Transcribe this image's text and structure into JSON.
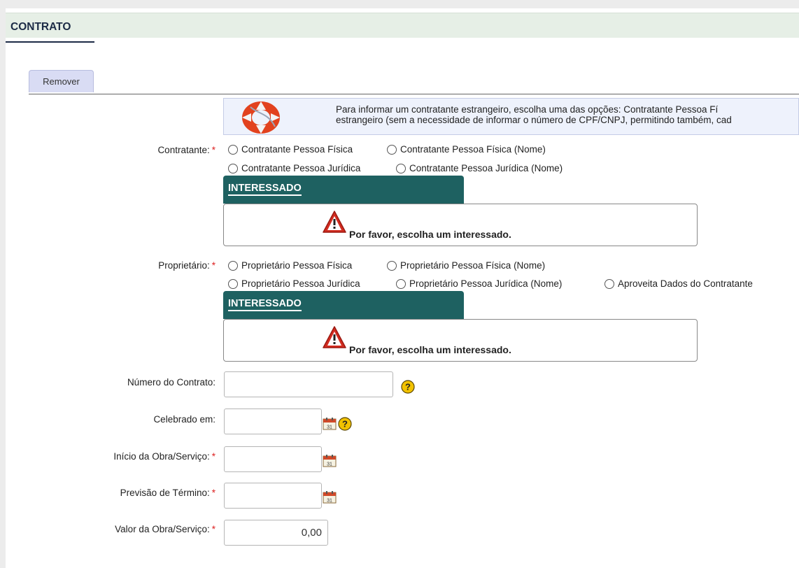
{
  "section": {
    "title": "CONTRATO"
  },
  "toolbar": {
    "remove_label": "Remover"
  },
  "info": {
    "line1": "Para informar um contratante estrangeiro, escolha uma das opções: Contratante Pessoa Fí",
    "line2": "estrangeiro (sem a necessidade de informar o número de CPF/CNPJ, permitindo também, cad"
  },
  "contratante": {
    "label": "Contratante:",
    "required_mark": "*",
    "options": [
      "Contratante Pessoa Física",
      "Contratante Pessoa Física (Nome)",
      "Contratante Pessoa Jurídica",
      "Contratante Pessoa Jurídica (Nome)"
    ],
    "panel_title": "INTERESSADO",
    "panel_message": "Por favor, escolha um interessado."
  },
  "proprietario": {
    "label": "Proprietário:",
    "required_mark": "*",
    "options": [
      "Proprietário Pessoa Física",
      "Proprietário Pessoa Física (Nome)",
      "Proprietário Pessoa Jurídica",
      "Proprietário Pessoa Jurídica (Nome)",
      "Aproveita Dados do Contratante"
    ],
    "panel_title": "INTERESSADO",
    "panel_message": "Por favor, escolha um interessado."
  },
  "fields": {
    "numero": {
      "label": "Número do Contrato:",
      "value": ""
    },
    "celebrado": {
      "label": "Celebrado em:",
      "value": ""
    },
    "inicio": {
      "label": "Início da Obra/Serviço:",
      "required_mark": "*",
      "value": ""
    },
    "previsao": {
      "label": "Previsão de Término:",
      "required_mark": "*",
      "value": ""
    },
    "valor": {
      "label": "Valor da Obra/Serviço:",
      "required_mark": "*",
      "value": "0,00"
    }
  },
  "colors": {
    "section_header_bg": "#e6efe6",
    "panel_header_bg": "#1e6161",
    "required": "#dd2222",
    "button_bg": "#d9dcf4",
    "info_bg": "#eef2fc"
  },
  "icons": [
    "lifebuoy-icon",
    "warning-icon",
    "calendar-icon",
    "help-icon"
  ]
}
